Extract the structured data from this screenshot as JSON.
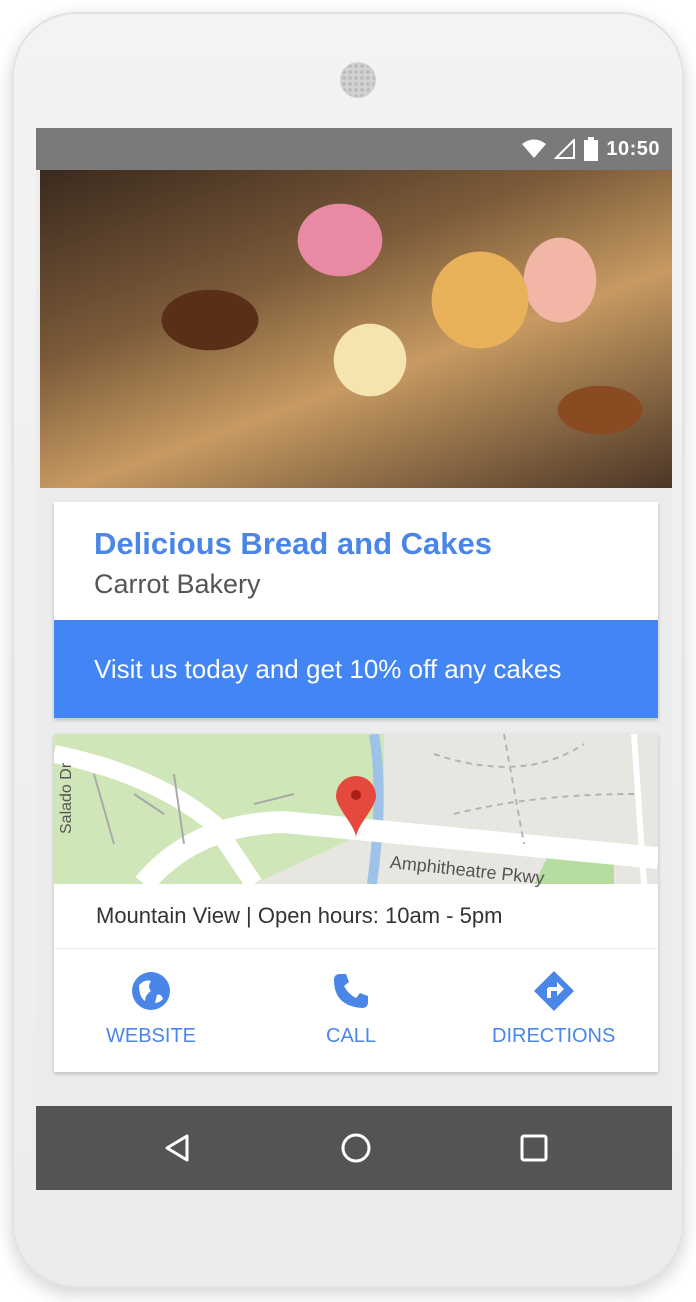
{
  "status_bar": {
    "time": "10:50",
    "icons": [
      "wifi-icon",
      "signal-icon",
      "battery-icon"
    ]
  },
  "hero": {
    "image": "bakery cakes photo"
  },
  "card": {
    "headline": "Delicious Bread and Cakes",
    "business_name": "Carrot Bakery",
    "promo": "Visit us today and get 10% off any cakes"
  },
  "map": {
    "street_main": "Amphitheatre Pkwy",
    "street_side": "Salado Dr",
    "info": "Mountain View | Open hours: 10am - 5pm"
  },
  "actions": [
    {
      "label": "WEBSITE",
      "icon": "globe-icon"
    },
    {
      "label": "CALL",
      "icon": "phone-icon"
    },
    {
      "label": "DIRECTIONS",
      "icon": "directions-icon"
    }
  ],
  "colors": {
    "accent": "#4285f4",
    "headline": "#4a86e8",
    "navbar": "#545454",
    "statusbar": "#7a7a7a"
  }
}
